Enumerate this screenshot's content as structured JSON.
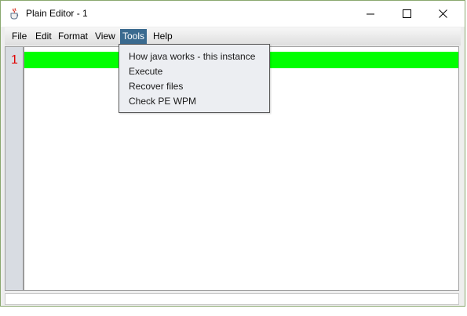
{
  "window": {
    "title": "Plain Editor - 1",
    "icon": "java-cup-icon"
  },
  "controls": {
    "minimize": "minimize-icon",
    "maximize": "maximize-icon",
    "close": "close-icon"
  },
  "menubar": {
    "items": [
      {
        "label": "File"
      },
      {
        "label": "Edit"
      },
      {
        "label": "Format"
      },
      {
        "label": "View"
      },
      {
        "label": "Tools",
        "active": true
      },
      {
        "label": "Help"
      }
    ]
  },
  "tools_menu": {
    "items": [
      {
        "label": "How java works - this instance"
      },
      {
        "label": "Execute"
      },
      {
        "label": "Recover files"
      },
      {
        "label": "Check PE WPM"
      }
    ]
  },
  "editor": {
    "line_numbers": [
      "1"
    ],
    "current_line_highlight": "#00ff00",
    "line_number_color": "#e00000"
  },
  "colors": {
    "menu_active_bg": "#3a6a8f",
    "window_border": "#8aa86f"
  }
}
